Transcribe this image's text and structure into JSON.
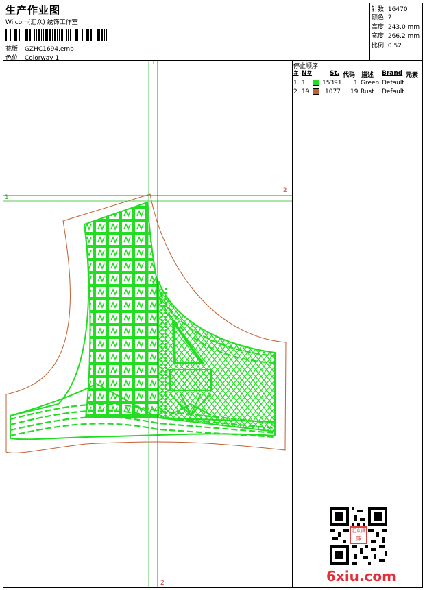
{
  "header": {
    "title": "生产作业图",
    "company": "Wilcom(汇众) 绣饰工作室",
    "design_label": "花版:",
    "design_value": "GZHC1694.emb",
    "colorway_label": "色位:",
    "colorway_value": "Colorway 1"
  },
  "stats": {
    "stitches_label": "针数:",
    "stitches_value": "16470",
    "colors_label": "颜色:",
    "colors_value": "2",
    "height_label": "高度:",
    "height_value": "243.0 mm",
    "width_label": "宽度:",
    "width_value": "266.2 mm",
    "scale_label": "比例:",
    "scale_value": "0.52"
  },
  "stop_order": {
    "title": "停止顺序:",
    "columns": [
      "#",
      "N#",
      "St.",
      "代码",
      "描述",
      "Brand",
      "元素"
    ],
    "rows": [
      {
        "idx": "1.",
        "n": "1",
        "color": "#22dd22",
        "st": "15391",
        "code": "1",
        "desc": "Green",
        "brand": "Default"
      },
      {
        "idx": "2.",
        "n": "19",
        "color": "#c06030",
        "st": "1077",
        "code": "19",
        "desc": "Rust",
        "brand": "Default"
      }
    ]
  },
  "guides": {
    "v1": "1",
    "h1": "1",
    "h2": "2",
    "v2": "2"
  },
  "watermark": {
    "text": "6xiu.com",
    "seal_text": "汇众绣饰"
  },
  "colors": {
    "green": "#22dd22",
    "rust": "#c06030",
    "guide_green": "#55cc55",
    "guide_red": "#cc3333"
  }
}
